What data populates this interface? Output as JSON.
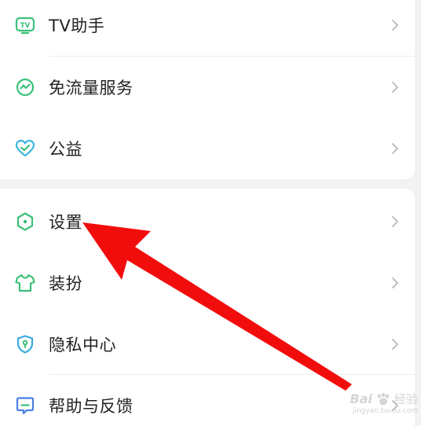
{
  "colors": {
    "accent": "#3cc07a",
    "arrow": "#f20d0d",
    "background": "#f2f2f4",
    "card": "#ffffff",
    "text": "#222222",
    "chevron": "#b8b8b8"
  },
  "menu_top": {
    "items": [
      {
        "label": "TV助手",
        "icon": "tv-icon"
      },
      {
        "label": "免流量服务",
        "icon": "traffic-icon"
      },
      {
        "label": "公益",
        "icon": "heart-icon"
      }
    ]
  },
  "menu_bottom": {
    "items": [
      {
        "label": "设置",
        "icon": "settings-icon"
      },
      {
        "label": "装扮",
        "icon": "tshirt-icon"
      },
      {
        "label": "隐私中心",
        "icon": "shield-icon"
      },
      {
        "label": "帮助与反馈",
        "icon": "chat-icon"
      }
    ]
  },
  "watermark": {
    "brand": "Bai",
    "brand_cn": "经验",
    "url": "jingyan.baidu.com"
  }
}
